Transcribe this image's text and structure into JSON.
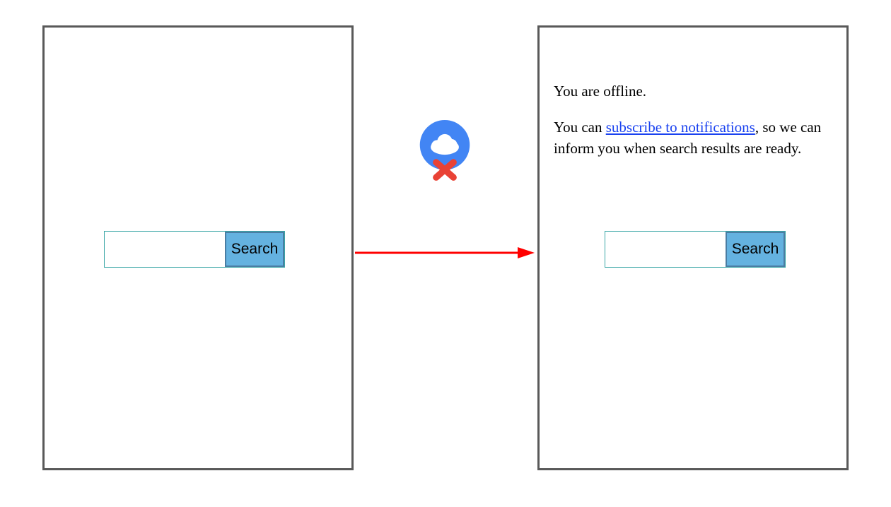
{
  "left_panel": {
    "search": {
      "value": "",
      "button_label": "Search"
    }
  },
  "right_panel": {
    "offline": {
      "line1": "You are offline.",
      "line2_before": "You can ",
      "line2_link": "subscribe to notifications",
      "line2_after": ", so we can inform you when search results are ready."
    },
    "search": {
      "value": "",
      "button_label": "Search"
    }
  },
  "colors": {
    "panel_border": "#595959",
    "search_border": "#3aa6a6",
    "button_fill": "#64b2e0",
    "button_border": "#4a7da3",
    "link": "#1a42f0",
    "arrow": "#ff0000",
    "badge_fill": "#4285f4",
    "badge_x": "#e94235",
    "cloud": "#ffffff"
  }
}
